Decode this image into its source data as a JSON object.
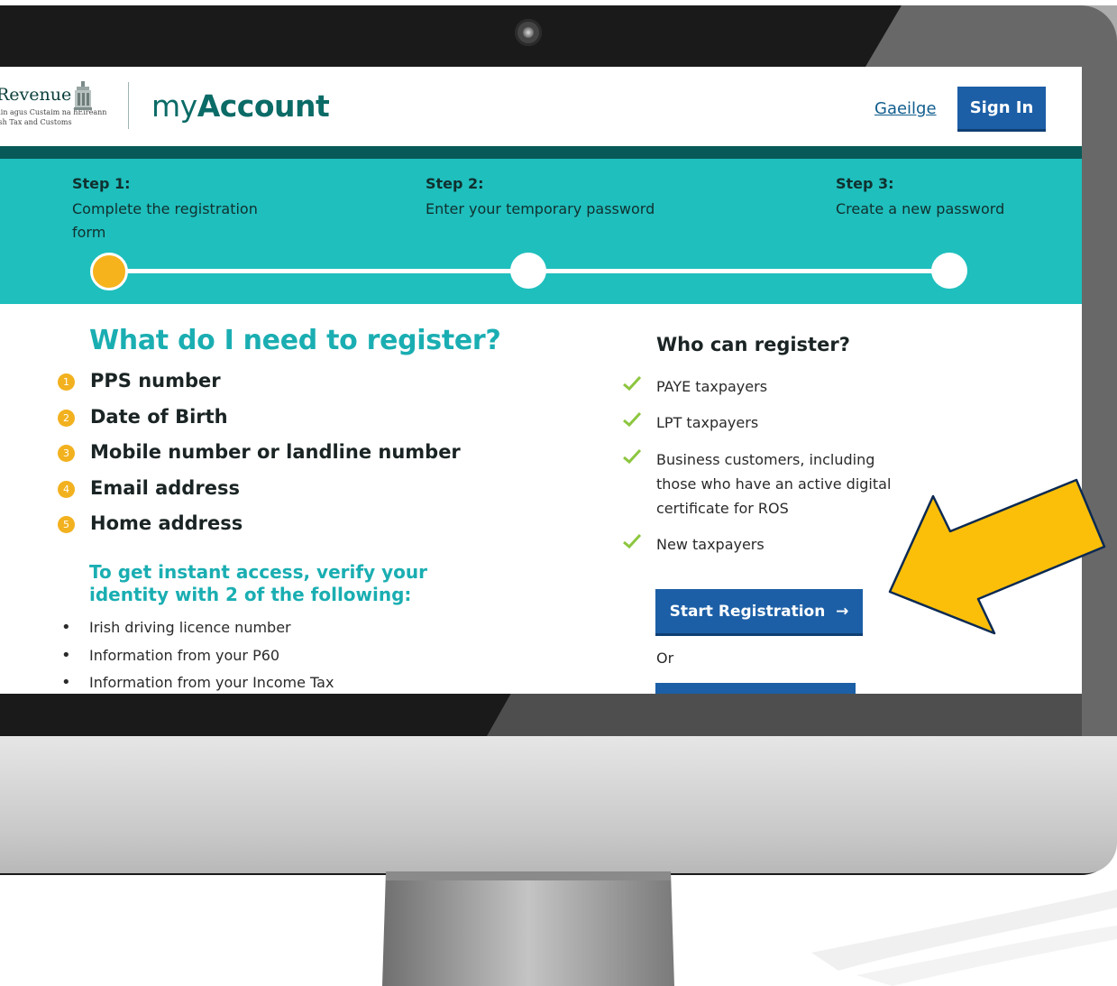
{
  "header": {
    "logo": {
      "word": "Revenue",
      "sub_line_1": "áin agus Custaim na hÉireann",
      "sub_line_2": "ish Tax and Customs"
    },
    "brand_prefix": "my",
    "brand_bold": "Account",
    "language_link": "Gaeilge",
    "sign_in_label": "Sign In"
  },
  "stepper": {
    "steps": [
      {
        "title": "Step 1:",
        "text": "Complete the registration form",
        "state": "current"
      },
      {
        "title": "Step 2:",
        "text": "Enter your temporary password",
        "state": "upcoming"
      },
      {
        "title": "Step 3:",
        "text": "Create a new password",
        "state": "upcoming"
      }
    ]
  },
  "requirements": {
    "title": "What do I need to register?",
    "items": [
      {
        "number": "1",
        "label": "PPS number"
      },
      {
        "number": "2",
        "label": "Date of Birth"
      },
      {
        "number": "3",
        "label": "Mobile number or landline number"
      },
      {
        "number": "4",
        "label": "Email address"
      },
      {
        "number": "5",
        "label": "Home address"
      }
    ],
    "instant_title": "To get instant access, verify your identity with 2 of the following:",
    "verify_options": [
      "Irish driving licence number",
      "Information from your P60",
      "Information from your Income Tax"
    ]
  },
  "who": {
    "title": "Who can register?",
    "items": [
      "PAYE taxpayers",
      "LPT taxpayers",
      "Business customers, including those who have an active digital certificate for ROS",
      "New taxpayers"
    ]
  },
  "actions": {
    "start_label": "Start Registration",
    "start_arrow": "→",
    "or_text": "Or"
  },
  "colors": {
    "accent_teal": "#1fbfbd",
    "header_rule": "#075a57",
    "button_blue": "#1c5fa6",
    "step_current": "#f6b31c",
    "highlight_arrow": "#fbbf0a"
  }
}
